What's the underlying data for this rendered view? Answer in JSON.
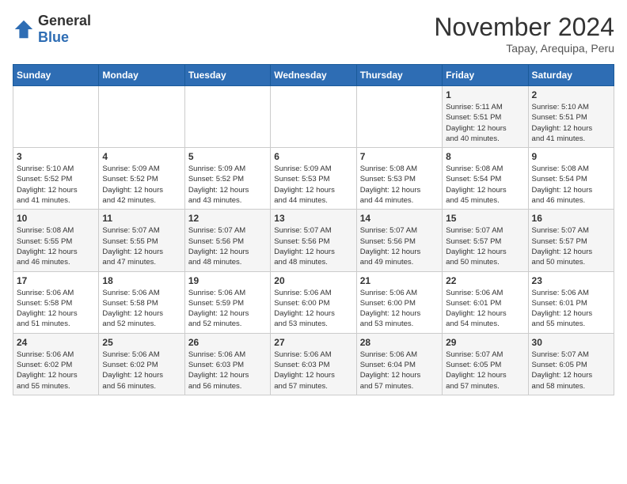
{
  "header": {
    "logo_general": "General",
    "logo_blue": "Blue",
    "month_title": "November 2024",
    "location": "Tapay, Arequipa, Peru"
  },
  "weekdays": [
    "Sunday",
    "Monday",
    "Tuesday",
    "Wednesday",
    "Thursday",
    "Friday",
    "Saturday"
  ],
  "weeks": [
    [
      {
        "day": "",
        "info": ""
      },
      {
        "day": "",
        "info": ""
      },
      {
        "day": "",
        "info": ""
      },
      {
        "day": "",
        "info": ""
      },
      {
        "day": "",
        "info": ""
      },
      {
        "day": "1",
        "info": "Sunrise: 5:11 AM\nSunset: 5:51 PM\nDaylight: 12 hours\nand 40 minutes."
      },
      {
        "day": "2",
        "info": "Sunrise: 5:10 AM\nSunset: 5:51 PM\nDaylight: 12 hours\nand 41 minutes."
      }
    ],
    [
      {
        "day": "3",
        "info": "Sunrise: 5:10 AM\nSunset: 5:52 PM\nDaylight: 12 hours\nand 41 minutes."
      },
      {
        "day": "4",
        "info": "Sunrise: 5:09 AM\nSunset: 5:52 PM\nDaylight: 12 hours\nand 42 minutes."
      },
      {
        "day": "5",
        "info": "Sunrise: 5:09 AM\nSunset: 5:52 PM\nDaylight: 12 hours\nand 43 minutes."
      },
      {
        "day": "6",
        "info": "Sunrise: 5:09 AM\nSunset: 5:53 PM\nDaylight: 12 hours\nand 44 minutes."
      },
      {
        "day": "7",
        "info": "Sunrise: 5:08 AM\nSunset: 5:53 PM\nDaylight: 12 hours\nand 44 minutes."
      },
      {
        "day": "8",
        "info": "Sunrise: 5:08 AM\nSunset: 5:54 PM\nDaylight: 12 hours\nand 45 minutes."
      },
      {
        "day": "9",
        "info": "Sunrise: 5:08 AM\nSunset: 5:54 PM\nDaylight: 12 hours\nand 46 minutes."
      }
    ],
    [
      {
        "day": "10",
        "info": "Sunrise: 5:08 AM\nSunset: 5:55 PM\nDaylight: 12 hours\nand 46 minutes."
      },
      {
        "day": "11",
        "info": "Sunrise: 5:07 AM\nSunset: 5:55 PM\nDaylight: 12 hours\nand 47 minutes."
      },
      {
        "day": "12",
        "info": "Sunrise: 5:07 AM\nSunset: 5:56 PM\nDaylight: 12 hours\nand 48 minutes."
      },
      {
        "day": "13",
        "info": "Sunrise: 5:07 AM\nSunset: 5:56 PM\nDaylight: 12 hours\nand 48 minutes."
      },
      {
        "day": "14",
        "info": "Sunrise: 5:07 AM\nSunset: 5:56 PM\nDaylight: 12 hours\nand 49 minutes."
      },
      {
        "day": "15",
        "info": "Sunrise: 5:07 AM\nSunset: 5:57 PM\nDaylight: 12 hours\nand 50 minutes."
      },
      {
        "day": "16",
        "info": "Sunrise: 5:07 AM\nSunset: 5:57 PM\nDaylight: 12 hours\nand 50 minutes."
      }
    ],
    [
      {
        "day": "17",
        "info": "Sunrise: 5:06 AM\nSunset: 5:58 PM\nDaylight: 12 hours\nand 51 minutes."
      },
      {
        "day": "18",
        "info": "Sunrise: 5:06 AM\nSunset: 5:58 PM\nDaylight: 12 hours\nand 52 minutes."
      },
      {
        "day": "19",
        "info": "Sunrise: 5:06 AM\nSunset: 5:59 PM\nDaylight: 12 hours\nand 52 minutes."
      },
      {
        "day": "20",
        "info": "Sunrise: 5:06 AM\nSunset: 6:00 PM\nDaylight: 12 hours\nand 53 minutes."
      },
      {
        "day": "21",
        "info": "Sunrise: 5:06 AM\nSunset: 6:00 PM\nDaylight: 12 hours\nand 53 minutes."
      },
      {
        "day": "22",
        "info": "Sunrise: 5:06 AM\nSunset: 6:01 PM\nDaylight: 12 hours\nand 54 minutes."
      },
      {
        "day": "23",
        "info": "Sunrise: 5:06 AM\nSunset: 6:01 PM\nDaylight: 12 hours\nand 55 minutes."
      }
    ],
    [
      {
        "day": "24",
        "info": "Sunrise: 5:06 AM\nSunset: 6:02 PM\nDaylight: 12 hours\nand 55 minutes."
      },
      {
        "day": "25",
        "info": "Sunrise: 5:06 AM\nSunset: 6:02 PM\nDaylight: 12 hours\nand 56 minutes."
      },
      {
        "day": "26",
        "info": "Sunrise: 5:06 AM\nSunset: 6:03 PM\nDaylight: 12 hours\nand 56 minutes."
      },
      {
        "day": "27",
        "info": "Sunrise: 5:06 AM\nSunset: 6:03 PM\nDaylight: 12 hours\nand 57 minutes."
      },
      {
        "day": "28",
        "info": "Sunrise: 5:06 AM\nSunset: 6:04 PM\nDaylight: 12 hours\nand 57 minutes."
      },
      {
        "day": "29",
        "info": "Sunrise: 5:07 AM\nSunset: 6:05 PM\nDaylight: 12 hours\nand 57 minutes."
      },
      {
        "day": "30",
        "info": "Sunrise: 5:07 AM\nSunset: 6:05 PM\nDaylight: 12 hours\nand 58 minutes."
      }
    ]
  ]
}
